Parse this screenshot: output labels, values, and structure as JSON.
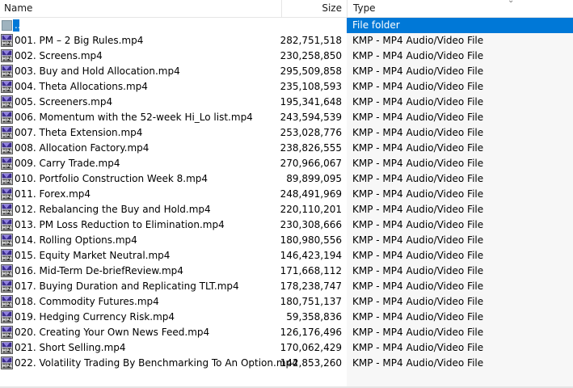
{
  "columns": {
    "name": "Name",
    "size": "Size",
    "type": "Type"
  },
  "icons": {
    "sort": "sort-chevron-icon",
    "file": "mp4-file-icon",
    "folder": "parent-folder-icon"
  },
  "colors": {
    "selection": "#0078d7",
    "icon_purple": "#3a2a8c"
  },
  "parent_row": {
    "name": "..",
    "type": "File folder"
  },
  "files": [
    {
      "name": "001. PM – 2 Big Rules.mp4",
      "size": "282,751,518",
      "type": "KMP - MP4 Audio/Video File"
    },
    {
      "name": "002. Screens.mp4",
      "size": "230,258,850",
      "type": "KMP - MP4 Audio/Video File"
    },
    {
      "name": "003. Buy and Hold Allocation.mp4",
      "size": "295,509,858",
      "type": "KMP - MP4 Audio/Video File"
    },
    {
      "name": "004. Theta Allocations.mp4",
      "size": "235,108,593",
      "type": "KMP - MP4 Audio/Video File"
    },
    {
      "name": "005. Screeners.mp4",
      "size": "195,341,648",
      "type": "KMP - MP4 Audio/Video File"
    },
    {
      "name": "006. Momentum with the 52-week Hi_Lo list.mp4",
      "size": "243,594,539",
      "type": "KMP - MP4 Audio/Video File"
    },
    {
      "name": "007. Theta Extension.mp4",
      "size": "253,028,776",
      "type": "KMP - MP4 Audio/Video File"
    },
    {
      "name": "008. Allocation Factory.mp4",
      "size": "238,826,555",
      "type": "KMP - MP4 Audio/Video File"
    },
    {
      "name": "009. Carry Trade.mp4",
      "size": "270,966,067",
      "type": "KMP - MP4 Audio/Video File"
    },
    {
      "name": "010. Portfolio Construction Week 8.mp4",
      "size": "89,899,095",
      "type": "KMP - MP4 Audio/Video File"
    },
    {
      "name": "011. Forex.mp4",
      "size": "248,491,969",
      "type": "KMP - MP4 Audio/Video File"
    },
    {
      "name": "012. Rebalancing the Buy and Hold.mp4",
      "size": "220,110,201",
      "type": "KMP - MP4 Audio/Video File"
    },
    {
      "name": "013. PM Loss Reduction to Elimination.mp4",
      "size": "230,308,666",
      "type": "KMP - MP4 Audio/Video File"
    },
    {
      "name": "014. Rolling Options.mp4",
      "size": "180,980,556",
      "type": "KMP - MP4 Audio/Video File"
    },
    {
      "name": "015. Equity Market Neutral.mp4",
      "size": "146,423,194",
      "type": "KMP - MP4 Audio/Video File"
    },
    {
      "name": "016. Mid-Term De-briefReview.mp4",
      "size": "171,668,112",
      "type": "KMP - MP4 Audio/Video File"
    },
    {
      "name": "017. Buying Duration and Replicating TLT.mp4",
      "size": "178,238,747",
      "type": "KMP - MP4 Audio/Video File"
    },
    {
      "name": "018. Commodity Futures.mp4",
      "size": "180,751,137",
      "type": "KMP - MP4 Audio/Video File"
    },
    {
      "name": "019. Hedging Currency Risk.mp4",
      "size": "59,358,836",
      "type": "KMP - MP4 Audio/Video File"
    },
    {
      "name": "020. Creating Your Own News Feed.mp4",
      "size": "126,176,496",
      "type": "KMP - MP4 Audio/Video File"
    },
    {
      "name": "021. Short Selling.mp4",
      "size": "170,062,429",
      "type": "KMP - MP4 Audio/Video File"
    },
    {
      "name": "022. Volatility Trading By Benchmarking To An Option.mp4",
      "size": "142,853,260",
      "type": "KMP - MP4 Audio/Video File"
    }
  ]
}
